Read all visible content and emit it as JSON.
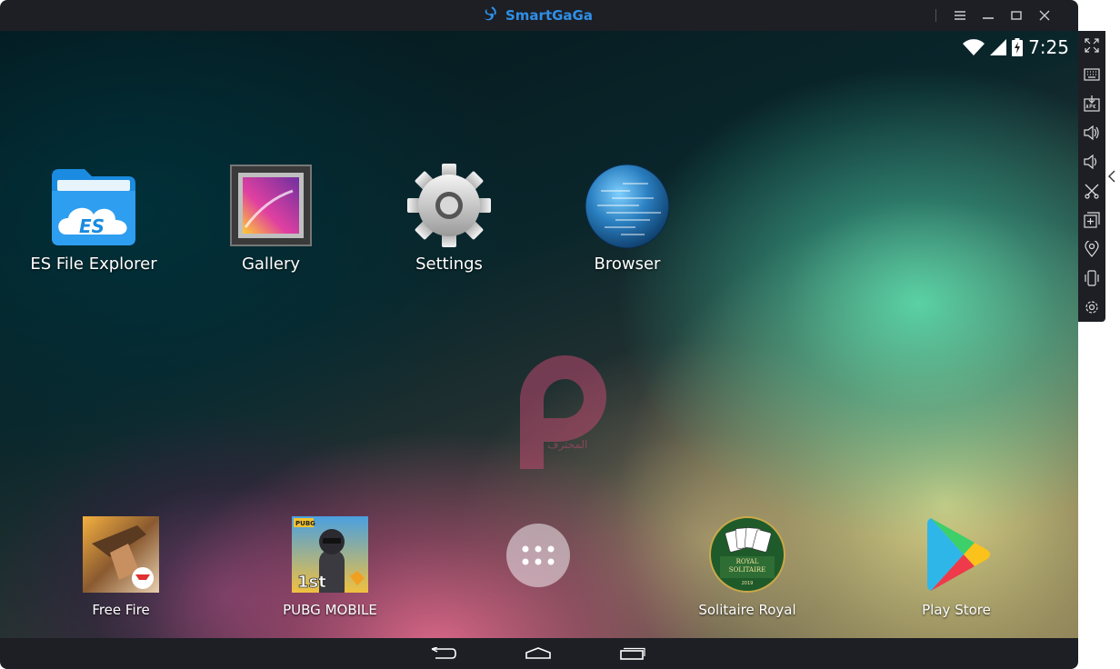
{
  "window": {
    "brand": "SmartGaGa",
    "controls": [
      "menu-icon",
      "minimize-icon",
      "maximize-icon",
      "close-icon"
    ]
  },
  "status_bar": {
    "time": "7:25",
    "icons": [
      "wifi-icon",
      "signal-icon",
      "battery-charging-icon"
    ]
  },
  "home_apps": [
    {
      "label": "ES File Explorer",
      "icon": "es-file-explorer-icon"
    },
    {
      "label": "Gallery",
      "icon": "gallery-icon"
    },
    {
      "label": "Settings",
      "icon": "settings-gear-icon"
    },
    {
      "label": "Browser",
      "icon": "browser-globe-icon"
    }
  ],
  "dock_apps": [
    {
      "label": "Free Fire",
      "icon": "free-fire-icon"
    },
    {
      "label": "PUBG MOBILE",
      "icon": "pubg-mobile-icon"
    },
    {
      "label": "Solitaire Royal",
      "icon": "solitaire-royal-icon"
    },
    {
      "label": "Play Store",
      "icon": "play-store-icon"
    }
  ],
  "icon_art": {
    "es_text": "ES",
    "pubg_tag": "PUBG",
    "pubg_rank": "1st",
    "solitaire_line1": "ROYAL",
    "solitaire_line2": "SOLITAIRE",
    "solitaire_year": "2019"
  },
  "watermark": {
    "text": "المحترف"
  },
  "nav": [
    "back-icon",
    "home-icon",
    "recents-icon"
  ],
  "sidebar": [
    "fullscreen-icon",
    "keyboard-icon",
    "apk-install-icon",
    "volume-up-icon",
    "volume-down-icon",
    "screenshot-scissors-icon",
    "multi-instance-icon",
    "location-icon",
    "shake-icon",
    "settings-icon"
  ],
  "colors": {
    "brand": "#2f8fe8",
    "chrome": "#1d1f24"
  }
}
